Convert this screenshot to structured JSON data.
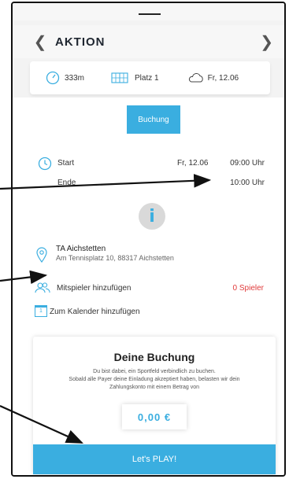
{
  "header": {
    "back_icon": "chevron-left-icon",
    "title": "AKTION",
    "forward_icon": "chevron-right-icon"
  },
  "info": {
    "distance": "333m",
    "court": "Platz 1",
    "weather_date": "Fr, 12.06"
  },
  "booking_button": "Buchung",
  "schedule": {
    "start_label": "Start",
    "start_date": "Fr, 12.06",
    "start_time": "09:00 Uhr",
    "end_label": "Ende",
    "end_time": "10:00 Uhr"
  },
  "info_symbol": "i",
  "location": {
    "name": "TA Aichstetten",
    "address": "Am Tennisplatz 10, 88317 Aichstetten"
  },
  "players": {
    "label": "Mitspieler hinzufügen",
    "count": "0 Spieler"
  },
  "calendar": {
    "label": "Zum Kalender hinzufügen",
    "icon_digit": "1"
  },
  "booking_card": {
    "title": "Deine Buchung",
    "body_line1": "Du bist dabei, ein Sportfeld verbindlich zu buchen.",
    "body_line2": "Sobald alle Payer deine Einladung akzeptiert haben, belasten wir dein",
    "body_line3": "Zahlungskonto mit einem Betrag von",
    "price": "0,00 €",
    "cta": "Let's PLAY!"
  },
  "colors": {
    "accent": "#3aaee0",
    "alert": "#e03a3a"
  }
}
